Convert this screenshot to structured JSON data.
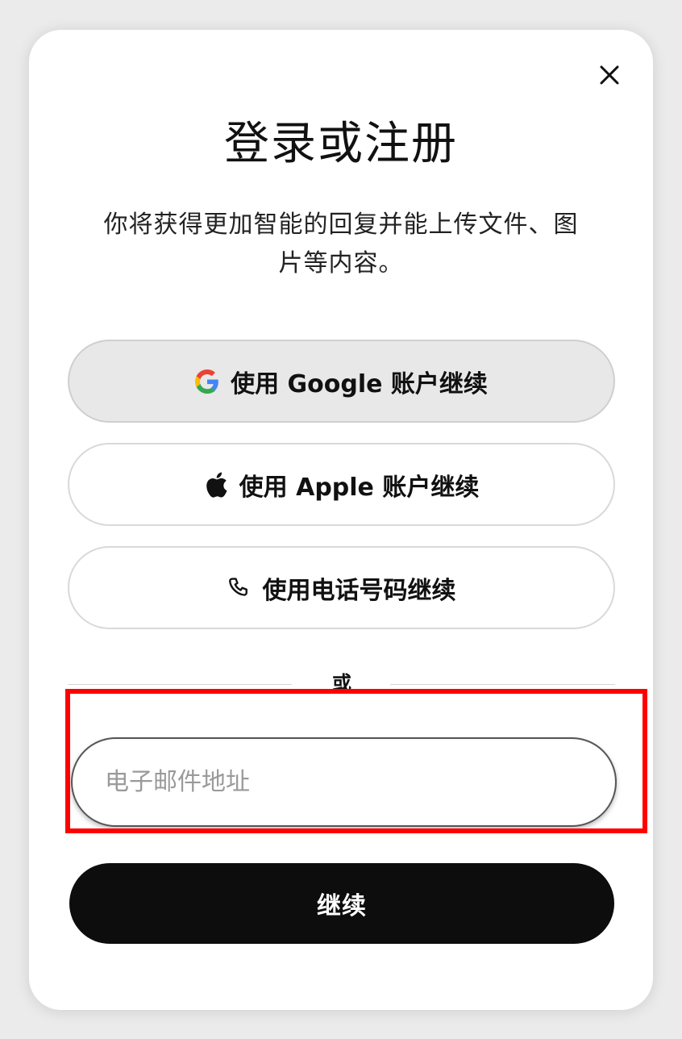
{
  "dialog": {
    "title": "登录或注册",
    "subtitle_line1": "你将获得更加智能的回复并能上传文件、图",
    "subtitle_line2": "片等内容。",
    "close_icon": "close-icon"
  },
  "auth_options": {
    "google_label": "使用 Google 账户继续",
    "apple_label": "使用 Apple 账户继续",
    "phone_label": "使用电话号码继续",
    "google_icon": "google-g-icon",
    "apple_icon": "apple-logo-icon",
    "phone_icon": "phone-icon"
  },
  "divider": {
    "text": "或"
  },
  "email": {
    "value": "",
    "placeholder": "电子邮件地址"
  },
  "submit": {
    "label": "继续"
  },
  "colors": {
    "highlight_border": "#ff0000",
    "primary_button": "#0d0d0d",
    "google_button_bg": "#e8e8e8"
  }
}
